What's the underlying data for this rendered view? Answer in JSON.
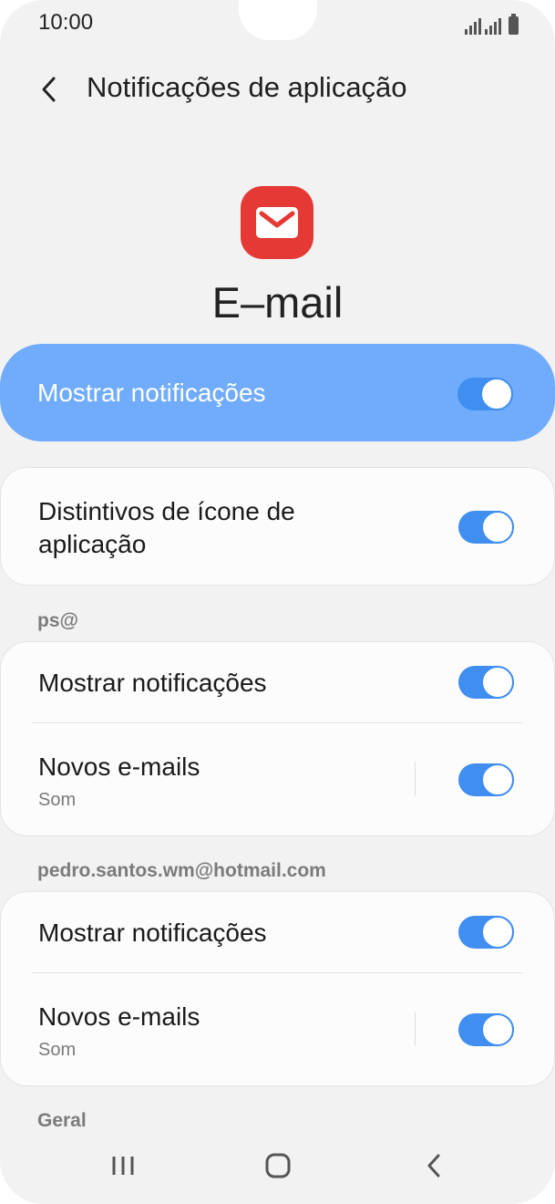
{
  "status_bar": {
    "time": "10:00"
  },
  "header": {
    "title": "Notificações de aplicação"
  },
  "app": {
    "name": "E–mail",
    "icon": "mail-icon",
    "icon_color": "#e53935"
  },
  "master_toggle": {
    "label": "Mostrar notificações",
    "on": true
  },
  "badges": {
    "label": "Distintivos de ícone de aplicação",
    "on": true
  },
  "accounts": [
    {
      "header": "ps@",
      "show_notifications": {
        "label": "Mostrar notificações",
        "on": true
      },
      "new_emails": {
        "label": "Novos e-mails",
        "subtitle": "Som",
        "on": true
      }
    },
    {
      "header": "pedro.santos.wm@hotmail.com",
      "show_notifications": {
        "label": "Mostrar notificações",
        "on": true
      },
      "new_emails": {
        "label": "Novos e-mails",
        "subtitle": "Som",
        "on": true
      }
    }
  ],
  "general_header": "Geral",
  "colors": {
    "accent": "#3f8ef0",
    "highlight": "#70acfb",
    "background": "#f2f2f2"
  },
  "navbar": {
    "icons": [
      "recent-apps-icon",
      "home-icon",
      "back-icon"
    ]
  }
}
